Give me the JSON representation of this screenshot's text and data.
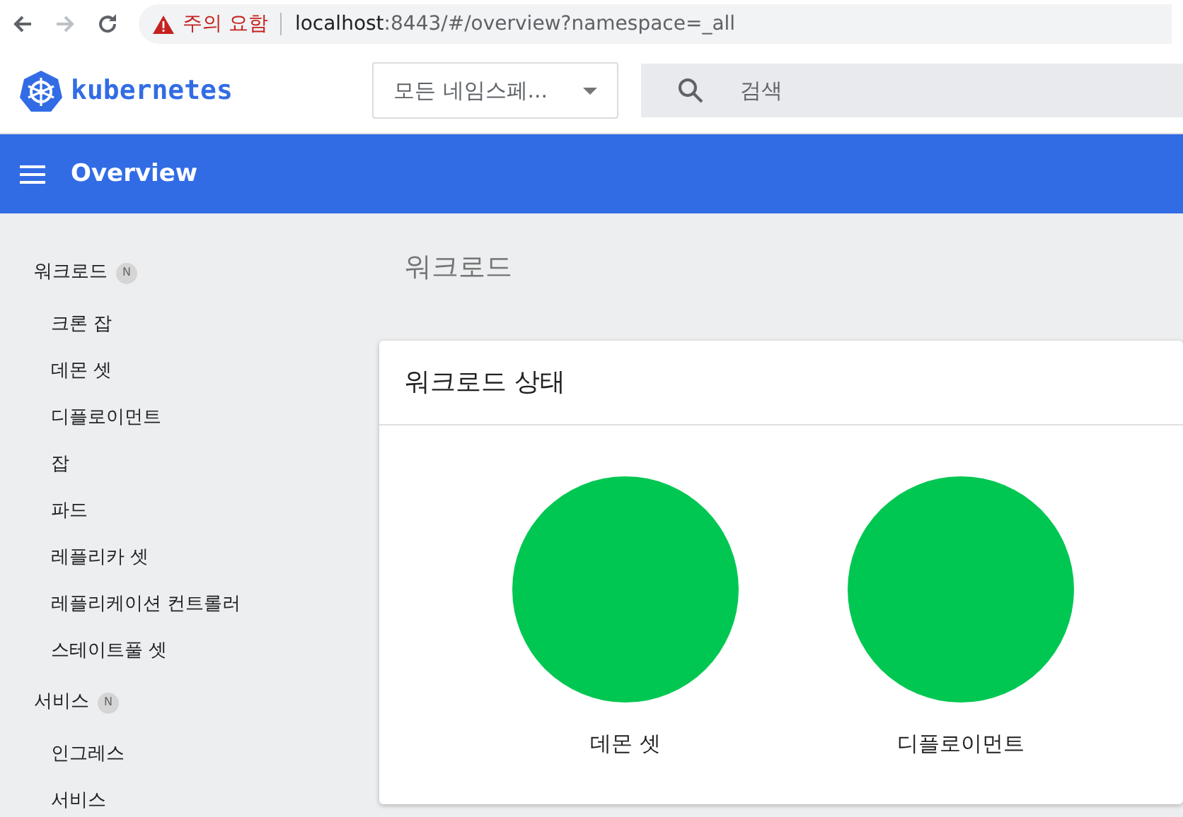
{
  "browser": {
    "warning": "주의 요함",
    "url_host": "localhost",
    "url_rest": ":8443/#/overview?namespace=_all"
  },
  "header": {
    "logo": "kubernetes",
    "namespace": "모든 네임스페...",
    "search_placeholder": "검색"
  },
  "toolbar": {
    "title": "Overview"
  },
  "sidebar": [
    {
      "title": "워크로드",
      "badge": "N",
      "items": [
        "크론 잡",
        "데몬 셋",
        "디플로이먼트",
        "잡",
        "파드",
        "레플리카 셋",
        "레플리케이션 컨트롤러",
        "스테이트풀 셋"
      ]
    },
    {
      "title": "서비스",
      "badge": "N",
      "items": [
        "인그레스",
        "서비스"
      ]
    }
  ],
  "main": {
    "heading": "워크로드",
    "card_title": "워크로드 상태",
    "statuses": [
      {
        "label": "데몬 셋",
        "color": "#00c752"
      },
      {
        "label": "디플로이먼트",
        "color": "#00c752"
      }
    ]
  }
}
